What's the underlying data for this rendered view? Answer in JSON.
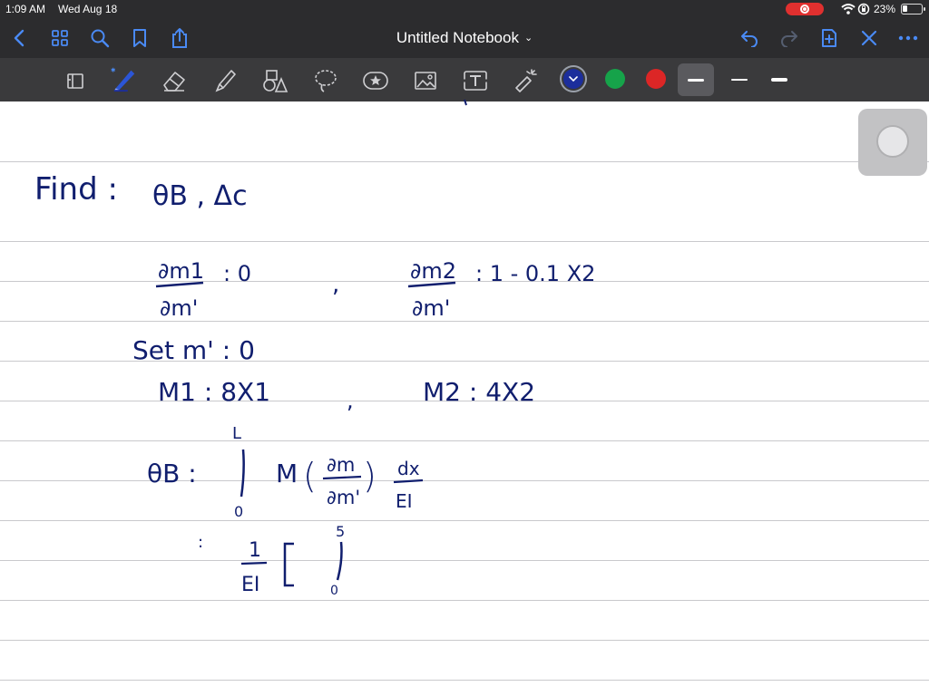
{
  "status": {
    "time": "1:09 AM",
    "date": "Wed Aug 18",
    "battery": "23%"
  },
  "nav": {
    "title": "Untitled Notebook"
  },
  "colors": {
    "accent": "#3b82f6",
    "swatch_blue": "#1c2e9c",
    "swatch_green": "#16a34a",
    "swatch_red": "#dc2626",
    "ink": "#101e6e"
  },
  "icons": {
    "nav_left": [
      "back-chevron-icon",
      "grid-icon",
      "search-icon",
      "bookmark-icon",
      "share-icon"
    ],
    "nav_right": [
      "undo-icon",
      "redo-icon",
      "add-page-icon",
      "close-icon",
      "more-icon"
    ],
    "tools": [
      "page-layout-icon",
      "pen-icon",
      "eraser-icon",
      "highlighter-icon",
      "shapes-icon",
      "lasso-icon",
      "sticker-icon",
      "image-icon",
      "text-icon",
      "laser-pointer-icon"
    ]
  },
  "note": {
    "find_label": "Find :",
    "find_vars": "θB , Δc",
    "eq1_num": "∂m1",
    "eq1_den": "∂m'",
    "eq1_rhs": ": 0",
    "eq2_num": "∂m2",
    "eq2_den": "∂m'",
    "eq2_rhs": ": 1 - 0.1 X2",
    "set_line": "Set   m' : 0",
    "m1": "M1 : 8X1",
    "m2": "M2 : 4X2",
    "theta_lhs": "θB :",
    "integral_upper": "L",
    "integral_lower": "0",
    "integrand": "M",
    "partial_num": "∂m",
    "partial_den": "∂m'",
    "dx_num": "dx",
    "dx_den": "EI",
    "line2_colon": ":",
    "frac_num": "1",
    "frac_den": "EI",
    "int2_upper": "5",
    "int2_lower": "0"
  }
}
